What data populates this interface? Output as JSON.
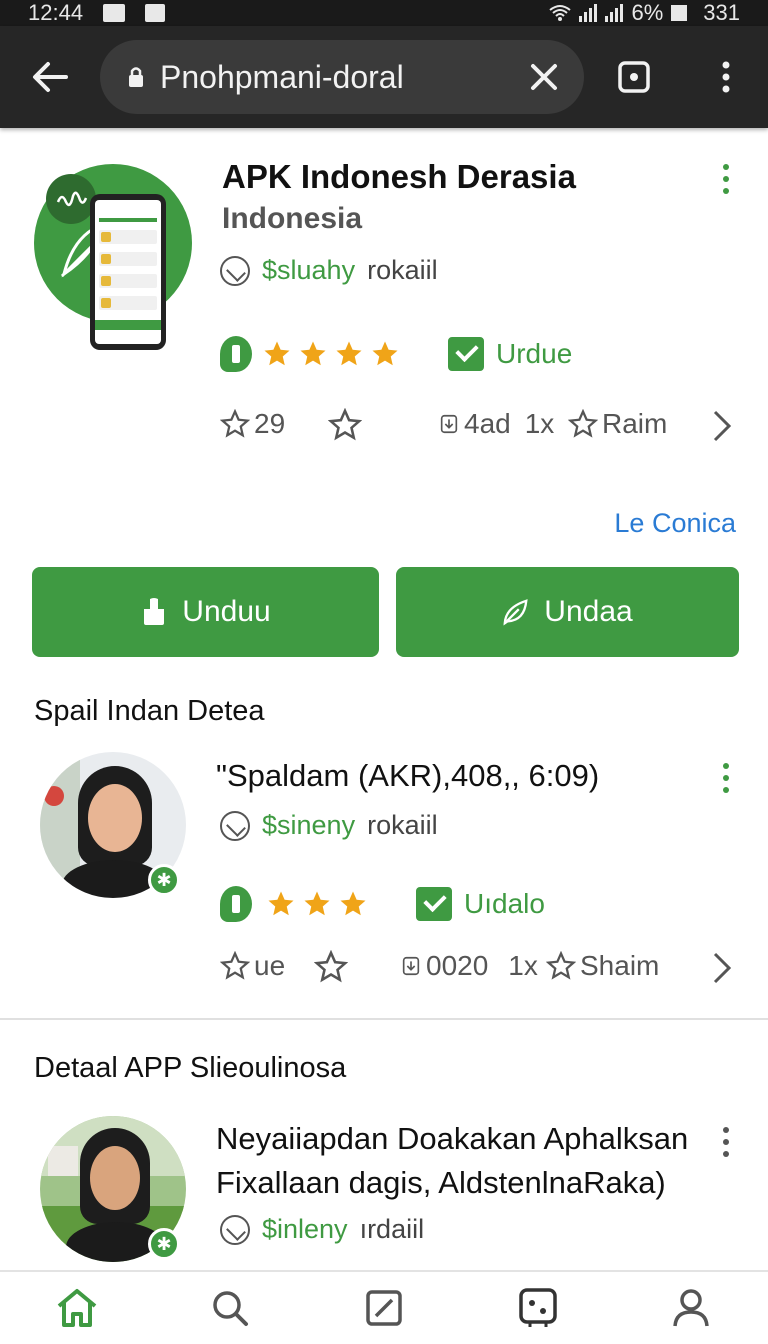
{
  "status_bar": {
    "time": "12:44",
    "battery": "6%",
    "extra": "331"
  },
  "browser": {
    "url": "Pnohpmani-doral"
  },
  "app": {
    "title": "APK Indonesh Derasia",
    "subtitle": "Indonesia",
    "developer": "$sluahy",
    "developer_suffix": "rokaiil",
    "tag": "Urdue",
    "stats": {
      "rating_count": "29",
      "downloads": "4ad",
      "mult": "1x",
      "share": "Raim"
    },
    "link": "Le Conica",
    "buttons": {
      "primary": "Unduu",
      "secondary": "Undaa"
    }
  },
  "section1": {
    "title": "Spail Indan Detea",
    "item": {
      "title": "\"Spaldam (AKR),408,, 6:09)",
      "developer": "$sineny",
      "developer_suffix": "rokaiil",
      "tag": "Uıdalo",
      "stats": {
        "rating_count": "ue",
        "downloads": "0020",
        "mult": "1x",
        "share": "Shaim"
      }
    }
  },
  "section2": {
    "title": "Detaal APP Slieoulinosa",
    "item": {
      "title_line1": "Neyaiiapdan Doakakan Aphalksan",
      "title_line2": "Fixallaan dagis, AldstenlnaRaka)",
      "developer": "$inleny",
      "developer_suffix": "ırdaiil"
    }
  },
  "colors": {
    "accent": "#3f9a42",
    "link": "#2a7bd4",
    "star": "#f0a418",
    "toolbar": "#262626"
  },
  "icons": [
    "arrow-left",
    "lock",
    "close",
    "tabs",
    "more-vert",
    "compass",
    "age-rating",
    "star",
    "check-badge",
    "chevron-right",
    "home",
    "search",
    "edit",
    "game",
    "person"
  ]
}
